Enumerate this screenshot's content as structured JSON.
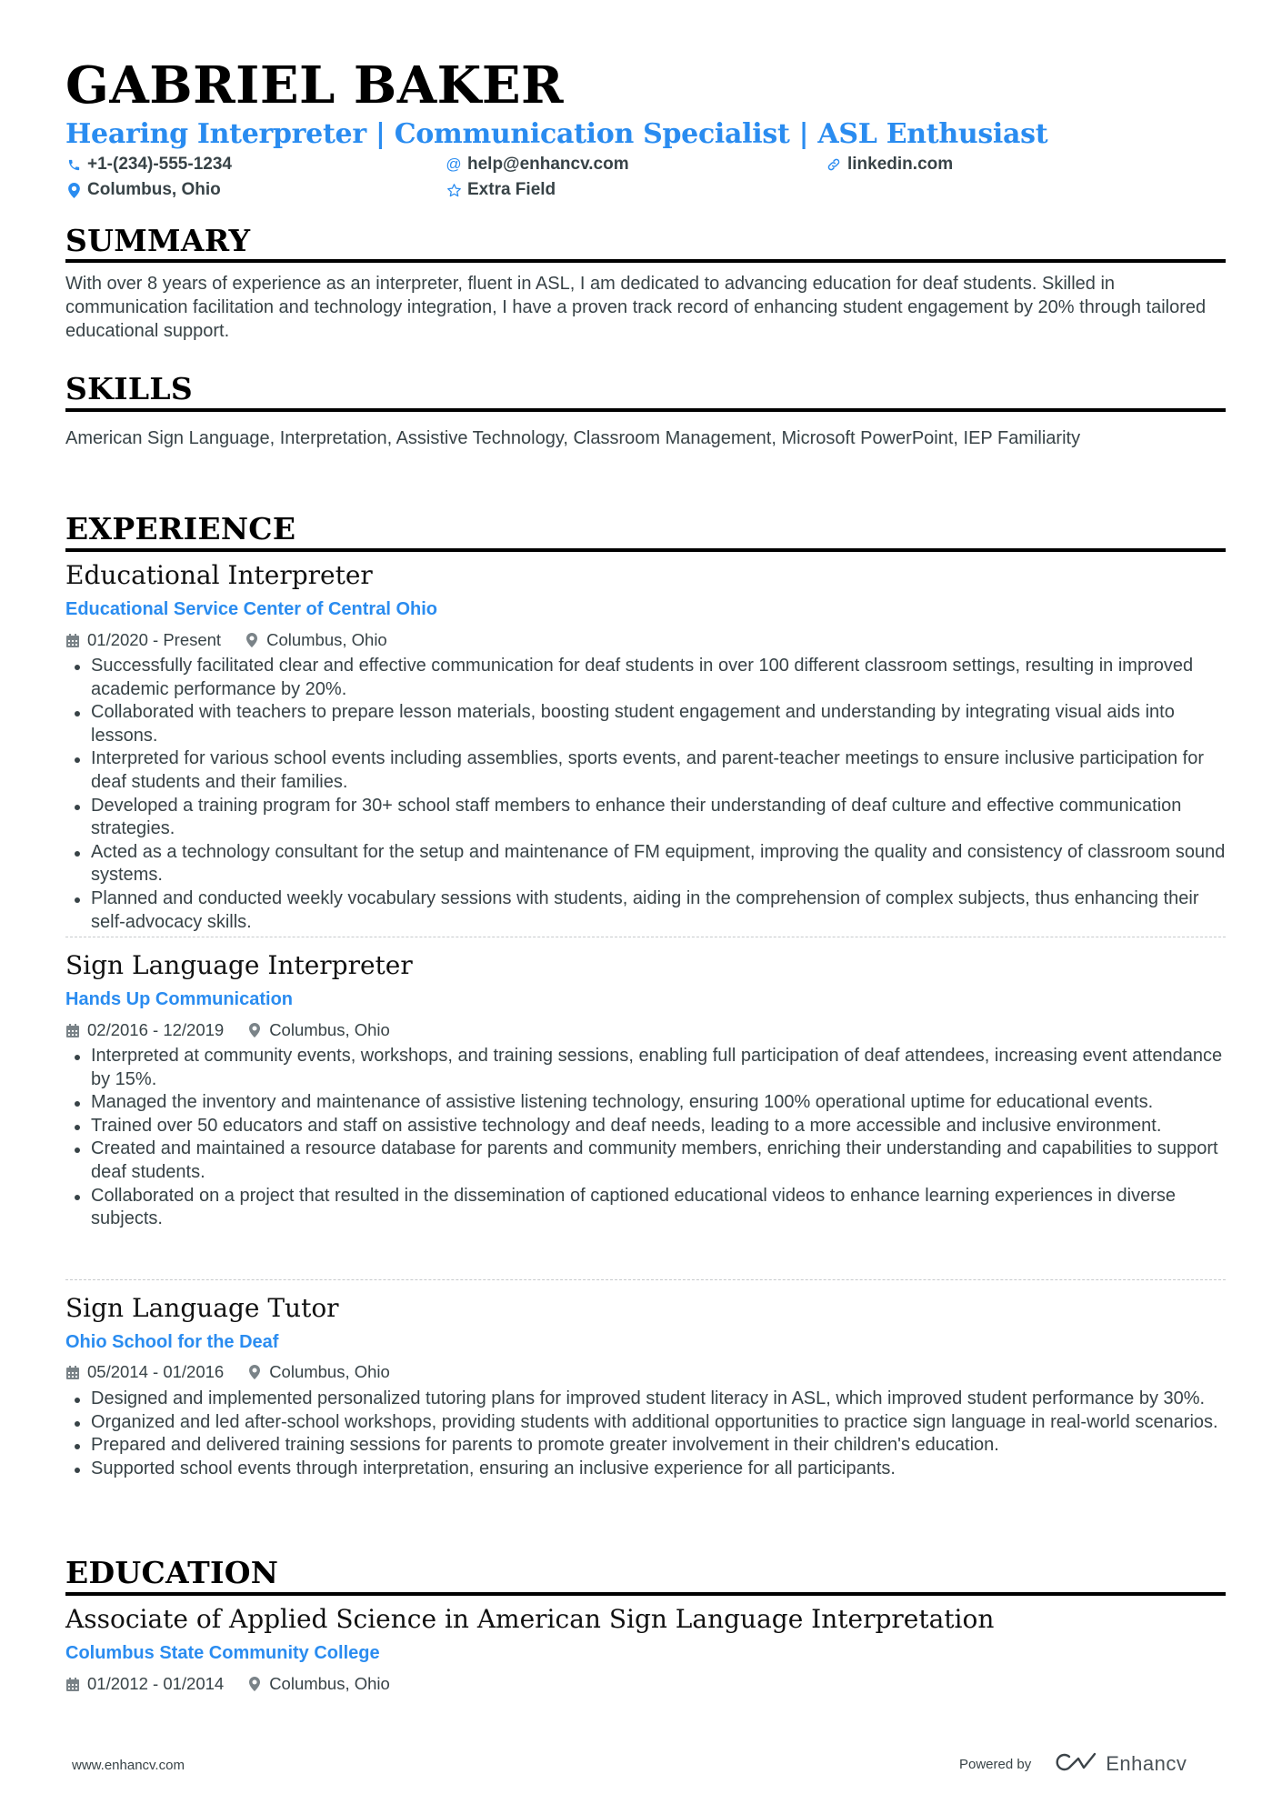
{
  "header": {
    "name": "GABRIEL BAKER",
    "title": "Hearing Interpreter | Communication Specialist | ASL Enthusiast",
    "contacts": {
      "phone": "+1-(234)-555-1234",
      "email": "help@enhancv.com",
      "linkedin": "linkedin.com",
      "location": "Columbus, Ohio",
      "extra": "Extra Field"
    }
  },
  "summary": {
    "heading": "SUMMARY",
    "text": "With over 8 years of experience as an interpreter, fluent in ASL, I am dedicated to advancing education for deaf students. Skilled in communication facilitation and technology integration, I have a proven track record of enhancing student engagement by 20% through tailored educational support."
  },
  "skills": {
    "heading": "SKILLS",
    "text": "American Sign Language, Interpretation, Assistive Technology, Classroom Management, Microsoft PowerPoint, IEP Familiarity"
  },
  "experience": {
    "heading": "EXPERIENCE",
    "jobs": [
      {
        "title": "Educational Interpreter",
        "company": "Educational Service Center of Central Ohio",
        "dates": "01/2020 - Present",
        "location": "Columbus, Ohio",
        "bullets": [
          "Successfully facilitated clear and effective communication for deaf students in over 100 different classroom settings, resulting in improved academic performance by 20%.",
          "Collaborated with teachers to prepare lesson materials, boosting student engagement and understanding by integrating visual aids into lessons.",
          "Interpreted for various school events including assemblies, sports events, and parent-teacher meetings to ensure inclusive participation for deaf students and their families.",
          "Developed a training program for 30+ school staff members to enhance their understanding of deaf culture and effective communication strategies.",
          "Acted as a technology consultant for the setup and maintenance of FM equipment, improving the quality and consistency of classroom sound systems.",
          "Planned and conducted weekly vocabulary sessions with students, aiding in the comprehension of complex subjects, thus enhancing their self-advocacy skills."
        ]
      },
      {
        "title": "Sign Language Interpreter",
        "company": "Hands Up Communication",
        "dates": "02/2016 - 12/2019",
        "location": "Columbus, Ohio",
        "bullets": [
          "Interpreted at community events, workshops, and training sessions, enabling full participation of deaf attendees, increasing event attendance by 15%.",
          "Managed the inventory and maintenance of assistive listening technology, ensuring 100% operational uptime for educational events.",
          "Trained over 50 educators and staff on assistive technology and deaf needs, leading to a more accessible and inclusive environment.",
          "Created and maintained a resource database for parents and community members, enriching their understanding and capabilities to support deaf students.",
          "Collaborated on a project that resulted in the dissemination of captioned educational videos to enhance learning experiences in diverse subjects."
        ]
      },
      {
        "title": "Sign Language Tutor",
        "company": "Ohio School for the Deaf",
        "dates": "05/2014 - 01/2016",
        "location": "Columbus, Ohio",
        "bullets": [
          "Designed and implemented personalized tutoring plans for improved student literacy in ASL, which improved student performance by 30%.",
          "Organized and led after-school workshops, providing students with additional opportunities to practice sign language in real-world scenarios.",
          "Prepared and delivered training sessions for parents to promote greater involvement in their children's education.",
          "Supported school events through interpretation, ensuring an inclusive experience for all participants."
        ]
      }
    ]
  },
  "education": {
    "heading": "EDUCATION",
    "degree": "Associate of Applied Science in American Sign Language Interpretation",
    "school": "Columbus State Community College",
    "dates": "01/2012 - 01/2014",
    "location": "Columbus, Ohio"
  },
  "footer": {
    "website": "www.enhancv.com",
    "powered_by": "Powered by",
    "brand": "Enhancv"
  },
  "colors": {
    "accent": "#2a8cf0",
    "text": "#384347",
    "heading": "#000000"
  }
}
